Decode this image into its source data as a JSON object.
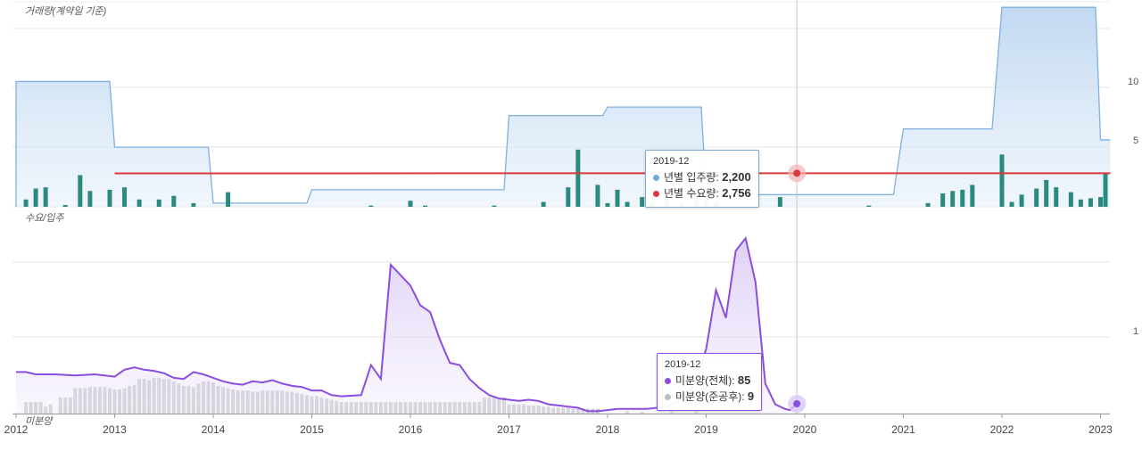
{
  "chart_data": [
    {
      "type": "area",
      "panel_label": "거래량(계약일 기준)",
      "x_ticks": [
        "2012",
        "2013",
        "2014",
        "2015",
        "2016",
        "2017",
        "2018",
        "2019",
        "2020",
        "2021",
        "2022",
        "2023"
      ],
      "ytick_labels_visible": [
        "10",
        "5"
      ],
      "ylim": [
        0,
        17
      ],
      "series": [
        {
          "name": "년별 입주량",
          "type": "step-area",
          "color": "#7fb0e0",
          "steps": [
            {
              "from": 2012.0,
              "to": 2012.95,
              "value": 10.3
            },
            {
              "from": 2013.0,
              "to": 2013.95,
              "value": 4.9
            },
            {
              "from": 2014.0,
              "to": 2014.95,
              "value": 0.3
            },
            {
              "from": 2015.0,
              "to": 2016.95,
              "value": 1.4
            },
            {
              "from": 2017.0,
              "to": 2017.95,
              "value": 7.5
            },
            {
              "from": 2018.0,
              "to": 2018.95,
              "value": 8.2
            },
            {
              "from": 2019.0,
              "to": 2020.9,
              "value": 1.0
            },
            {
              "from": 2021.0,
              "to": 2021.9,
              "value": 6.4
            },
            {
              "from": 2022.0,
              "to": 2022.95,
              "value": 16.4
            },
            {
              "from": 2023.0,
              "to": 2023.1,
              "value": 5.5
            }
          ]
        },
        {
          "name": "년별 수요량",
          "type": "line",
          "color": "#d93a3a",
          "x": [
            2013.0,
            2023.1
          ],
          "y": [
            2.75,
            2.76
          ]
        },
        {
          "name": "거래량",
          "type": "bar",
          "color": "#2a8a80",
          "x": [
            2012.1,
            2012.2,
            2012.3,
            2012.5,
            2012.65,
            2012.75,
            2012.95,
            2013.1,
            2013.25,
            2013.45,
            2013.6,
            2013.8,
            2014.15,
            2015.6,
            2016.0,
            2016.15,
            2016.85,
            2017.35,
            2017.6,
            2017.7,
            2017.9,
            2018.0,
            2018.1,
            2018.2,
            2018.35,
            2018.45,
            2018.6,
            2018.75,
            2018.9,
            2019.0,
            2019.1,
            2019.75,
            2020.65,
            2021.25,
            2021.4,
            2021.5,
            2021.6,
            2021.7,
            2022.0,
            2022.1,
            2022.2,
            2022.35,
            2022.45,
            2022.55,
            2022.7,
            2022.8,
            2022.9,
            2023.0,
            2023.05
          ],
          "values": [
            0.6,
            1.5,
            1.6,
            0.15,
            2.6,
            1.3,
            1.4,
            1.6,
            0.6,
            0.6,
            0.9,
            0.3,
            1.2,
            0.1,
            0.5,
            0.1,
            0.1,
            0.4,
            1.6,
            4.7,
            1.8,
            0.3,
            1.4,
            0.4,
            0.8,
            0.4,
            0.7,
            0.3,
            1.1,
            0.5,
            0.4,
            0.8,
            0.1,
            0.3,
            1.1,
            1.3,
            1.4,
            1.8,
            4.3,
            0.4,
            1.0,
            1.5,
            2.2,
            1.6,
            1.2,
            0.6,
            0.7,
            0.8,
            2.8
          ]
        }
      ]
    },
    {
      "type": "area",
      "panel_label": "수요/입주",
      "bottom_label": "미분양",
      "x_ticks": [
        "2012",
        "2013",
        "2014",
        "2015",
        "2016",
        "2017",
        "2018",
        "2019",
        "2020",
        "2021",
        "2022",
        "2023"
      ],
      "ytick_labels_visible": [
        "1"
      ],
      "ylim": [
        0,
        1700
      ],
      "series": [
        {
          "name": "미분양(전체)",
          "type": "line",
          "color": "#8a4ee0",
          "x": [
            2012.0,
            2012.1,
            2012.2,
            2012.4,
            2012.6,
            2012.8,
            2013.0,
            2013.1,
            2013.2,
            2013.3,
            2013.4,
            2013.5,
            2013.6,
            2013.7,
            2013.8,
            2013.9,
            2014.0,
            2014.1,
            2014.2,
            2014.3,
            2014.4,
            2014.5,
            2014.6,
            2014.7,
            2014.8,
            2014.9,
            2015.0,
            2015.1,
            2015.2,
            2015.3,
            2015.5,
            2015.6,
            2015.7,
            2015.8,
            2015.9,
            2016.0,
            2016.1,
            2016.2,
            2016.3,
            2016.4,
            2016.5,
            2016.6,
            2016.7,
            2016.8,
            2016.9,
            2017.0,
            2017.1,
            2017.2,
            2017.3,
            2017.4,
            2017.5,
            2017.6,
            2017.7,
            2017.8,
            2017.9,
            2018.0,
            2018.1,
            2018.2,
            2018.4,
            2018.6,
            2018.8,
            2018.9,
            2019.0,
            2019.1,
            2019.2,
            2019.3,
            2019.4,
            2019.5,
            2019.6,
            2019.7,
            2019.8,
            2019.85,
            2019.92
          ],
          "y": [
            360,
            360,
            340,
            340,
            330,
            340,
            320,
            380,
            400,
            380,
            370,
            350,
            310,
            300,
            360,
            340,
            310,
            280,
            260,
            250,
            280,
            270,
            290,
            260,
            240,
            230,
            200,
            200,
            160,
            150,
            160,
            420,
            300,
            1290,
            1200,
            1110,
            940,
            880,
            640,
            440,
            420,
            300,
            220,
            160,
            130,
            120,
            110,
            120,
            110,
            80,
            70,
            60,
            50,
            20,
            20,
            30,
            40,
            40,
            40,
            60,
            130,
            290,
            560,
            1070,
            830,
            1410,
            1520,
            1140,
            260,
            80,
            40,
            30,
            85
          ]
        },
        {
          "name": "미분양(준공후)",
          "type": "bar",
          "color": "#bdbdbd",
          "x": [
            2012.1,
            2012.15,
            2012.2,
            2012.25,
            2012.3,
            2012.35,
            2012.45,
            2012.5,
            2012.55,
            2012.6,
            2012.65,
            2012.7,
            2012.75,
            2012.8,
            2012.85,
            2012.9,
            2012.95,
            2013.0,
            2013.05,
            2013.1,
            2013.15,
            2013.2,
            2013.25,
            2013.3,
            2013.35,
            2013.4,
            2013.45,
            2013.5,
            2013.55,
            2013.6,
            2013.65,
            2013.7,
            2013.75,
            2013.8,
            2013.85,
            2013.9,
            2013.95,
            2014.0,
            2014.05,
            2014.1,
            2014.15,
            2014.2,
            2014.25,
            2014.3,
            2014.35,
            2014.4,
            2014.45,
            2014.5,
            2014.55,
            2014.6,
            2014.65,
            2014.7,
            2014.75,
            2014.8,
            2014.85,
            2014.9,
            2014.95,
            2015.0,
            2015.05,
            2015.1,
            2015.15,
            2015.2,
            2015.25,
            2015.3,
            2015.35,
            2015.4,
            2015.45,
            2015.5,
            2015.55,
            2015.6,
            2015.65,
            2015.7,
            2015.75,
            2015.8,
            2015.85,
            2015.9,
            2015.95,
            2016.0,
            2016.05,
            2016.1,
            2016.15,
            2016.2,
            2016.25,
            2016.3,
            2016.35,
            2016.4,
            2016.45,
            2016.5,
            2016.55,
            2016.6,
            2016.65,
            2016.7,
            2016.75,
            2016.8,
            2016.85,
            2016.9,
            2016.95,
            2017.0,
            2017.05,
            2017.1,
            2017.15,
            2017.2,
            2017.25,
            2017.3,
            2017.35,
            2017.4,
            2017.45,
            2017.5,
            2017.55,
            2017.6,
            2017.65,
            2017.7,
            2017.75,
            2017.8,
            2017.85,
            2017.9,
            2018.2,
            2018.35,
            2018.65,
            2018.9
          ],
          "values": [
            100,
            100,
            100,
            100,
            60,
            80,
            140,
            140,
            140,
            220,
            220,
            220,
            230,
            230,
            230,
            230,
            220,
            210,
            210,
            220,
            240,
            250,
            300,
            300,
            290,
            310,
            310,
            300,
            300,
            280,
            260,
            240,
            240,
            230,
            260,
            280,
            280,
            270,
            240,
            230,
            220,
            210,
            200,
            200,
            200,
            190,
            190,
            200,
            200,
            200,
            200,
            200,
            190,
            190,
            180,
            170,
            160,
            150,
            150,
            140,
            130,
            120,
            110,
            100,
            100,
            100,
            100,
            100,
            100,
            100,
            100,
            100,
            100,
            100,
            100,
            100,
            100,
            100,
            100,
            100,
            100,
            100,
            100,
            100,
            100,
            100,
            100,
            100,
            100,
            100,
            100,
            100,
            140,
            140,
            140,
            140,
            140,
            80,
            80,
            80,
            80,
            70,
            70,
            70,
            60,
            60,
            50,
            50,
            50,
            50,
            40,
            40,
            40,
            40,
            40,
            40,
            20,
            15,
            15,
            15
          ]
        }
      ]
    }
  ],
  "tooltips": {
    "top": {
      "date": "2019-12",
      "rows": [
        {
          "label": "년별 입주량",
          "value": "2,200",
          "color": "#6fa8dc"
        },
        {
          "label": "년별 수요량",
          "value": "2,756",
          "color": "#d93a3a"
        }
      ]
    },
    "bottom": {
      "date": "2019-12",
      "rows": [
        {
          "label": "미분양(전체)",
          "value": "85",
          "color": "#8a4ee0"
        },
        {
          "label": "미분양(준공후)",
          "value": "9",
          "color": "#bdbdbd"
        }
      ]
    }
  }
}
